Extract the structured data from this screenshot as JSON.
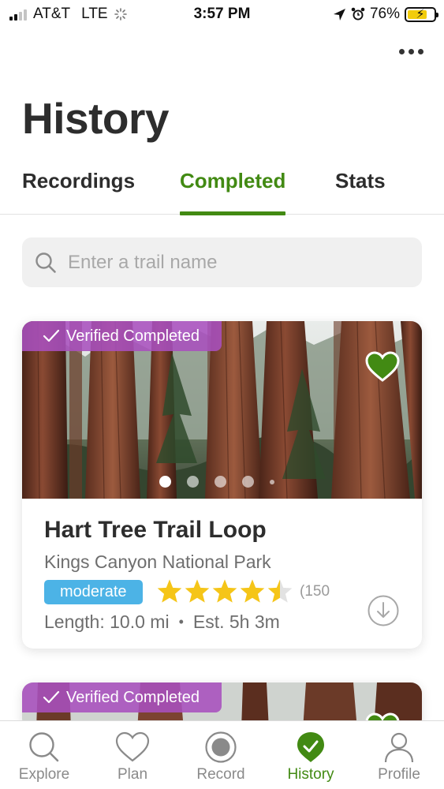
{
  "status_bar": {
    "carrier": "AT&T",
    "network": "LTE",
    "time": "3:57 PM",
    "battery": "76%",
    "battery_level": 0.76
  },
  "header": {
    "title": "History"
  },
  "tabs": [
    {
      "label": "Recordings",
      "active": false
    },
    {
      "label": "Completed",
      "active": true
    },
    {
      "label": "Stats",
      "active": false
    }
  ],
  "search": {
    "placeholder": "Enter a trail name",
    "value": ""
  },
  "trails": [
    {
      "badge": "Verified Completed",
      "favorited": true,
      "photo_count_shown": 5,
      "active_photo": 1,
      "name": "Hart Tree Trail Loop",
      "park": "Kings Canyon National Park",
      "difficulty": "moderate",
      "rating": 4.5,
      "review_count": "(150",
      "length": "Length: 10.0 mi",
      "separator": "•",
      "estimate": "Est. 5h 3m"
    },
    {
      "badge": "Verified Completed",
      "favorited": true
    }
  ],
  "bottom_nav": [
    {
      "label": "Explore",
      "icon": "search-icon",
      "active": false
    },
    {
      "label": "Plan",
      "icon": "heart-icon",
      "active": false
    },
    {
      "label": "Record",
      "icon": "record-icon",
      "active": false
    },
    {
      "label": "History",
      "icon": "check-badge-icon",
      "active": true
    },
    {
      "label": "Profile",
      "icon": "person-icon",
      "active": false
    }
  ],
  "colors": {
    "brand_green": "#428a13",
    "verified_purple": "#a850be",
    "difficulty_blue": "#4cb3e6",
    "star_yellow": "#f5c518"
  }
}
